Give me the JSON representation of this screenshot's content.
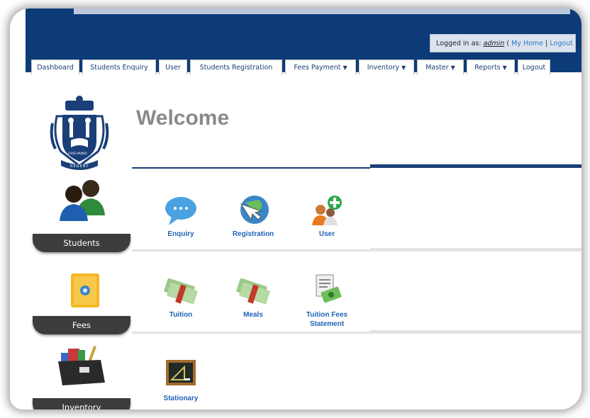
{
  "header": {
    "logged_in_prefix": "Logged in as:",
    "username": "admin",
    "my_home": "My Home",
    "logout_link": "Logout",
    "open_paren": "(",
    "separator": "|",
    "close_paren": ")"
  },
  "tabs": [
    {
      "label": "Dashboard"
    },
    {
      "label": "Students Enquiry"
    },
    {
      "label": "User"
    },
    {
      "label": "Students Registration"
    },
    {
      "label": "Fees Payment",
      "dropdown": true
    },
    {
      "label": "Inventory",
      "dropdown": true
    },
    {
      "label": "Master",
      "dropdown": true
    },
    {
      "label": "Reports",
      "dropdown": true
    },
    {
      "label": "Logout"
    }
  ],
  "main": {
    "welcome": "Welcome",
    "crest_motto": "CIVES MUNDI",
    "crest_name": "REGENT"
  },
  "categories": [
    {
      "label": "Students",
      "icon": "students-icon",
      "items": [
        {
          "label": "Enquiry",
          "icon": "chat-bubble-icon"
        },
        {
          "label": "Registration",
          "icon": "globe-cursor-icon"
        },
        {
          "label": "User",
          "icon": "add-user-icon"
        }
      ]
    },
    {
      "label": "Fees",
      "icon": "safe-icon",
      "items": [
        {
          "label": "Tuition",
          "icon": "money-icon"
        },
        {
          "label": "Meals",
          "icon": "money-icon"
        },
        {
          "label": "Tuition Fees Statement",
          "label_line1": "Tuition Fees",
          "label_line2": "Statement",
          "icon": "statement-icon"
        }
      ]
    },
    {
      "label": "Inventory",
      "icon": "box-icon",
      "items": [
        {
          "label": "Stationary",
          "icon": "chalkboard-icon"
        }
      ]
    }
  ],
  "colors": {
    "header_bg": "#0d3b78",
    "link_blue": "#1f63b8",
    "category_bg": "#3d3d3d",
    "welcome_gray": "#8a8a8a"
  }
}
